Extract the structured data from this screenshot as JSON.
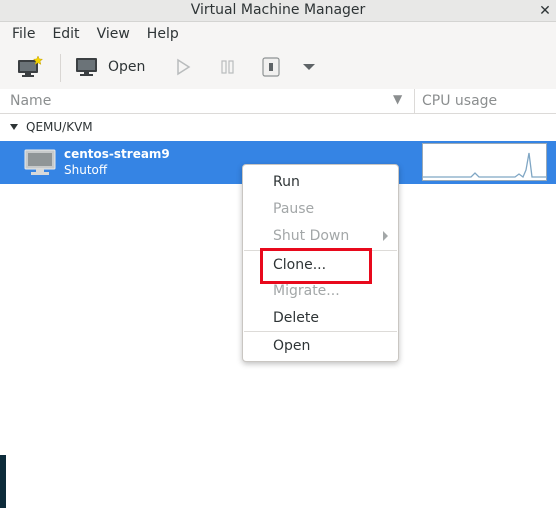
{
  "window": {
    "title": "Virtual Machine Manager",
    "close_glyph": "✕"
  },
  "menubar": {
    "items": [
      "File",
      "Edit",
      "View",
      "Help"
    ]
  },
  "toolbar": {
    "open_label": "Open"
  },
  "list_header": {
    "name": "Name",
    "cpu": "CPU usage"
  },
  "group": {
    "label": "QEMU/KVM"
  },
  "vm": {
    "name": "centos-stream9",
    "status": "Shutoff"
  },
  "context_menu": {
    "items": [
      {
        "label": "Run",
        "enabled": true
      },
      {
        "label": "Pause",
        "enabled": false
      },
      {
        "label": "Shut Down",
        "enabled": false,
        "submenu": true
      },
      {
        "label": "Clone...",
        "enabled": true,
        "highlighted": true
      },
      {
        "label": "Migrate...",
        "enabled": false
      },
      {
        "label": "Delete",
        "enabled": true
      },
      {
        "label": "Open",
        "enabled": true
      }
    ]
  },
  "colors": {
    "selection": "#3584e4",
    "highlight_box": "#e8091c",
    "disabled_text": "#a3a7a8",
    "graph_line": "#7fa6c4"
  }
}
